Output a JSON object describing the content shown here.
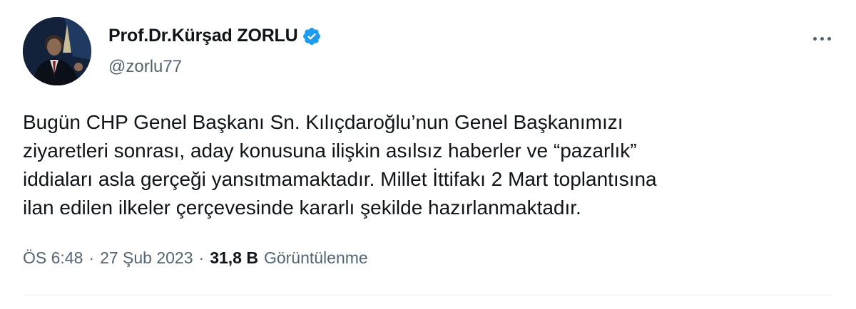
{
  "tweet": {
    "author": {
      "display_name": "Prof.Dr.Kürşad ZORLU",
      "handle": "@zorlu77",
      "verified": true
    },
    "text": "Bugün CHP Genel Başkanı Sn. Kılıçdaroğlu’nun Genel Başkanımızı\nziyaretleri sonrası, aday konusuna ilişkin asılsız haberler ve “pazarlık”\niddiaları asla gerçeği yansıtmamaktadır. Millet İttifakı 2 Mart toplantısına\nilan edilen ilkeler çerçevesinde kararlı şekilde hazırlanmaktadır.",
    "time": "ÖS 6:48",
    "separator": "·",
    "date": "27 Şub 2023",
    "views_count": "31,8 B",
    "views_label": "Görüntülenme"
  },
  "colors": {
    "verified_blue": "#1d9bf0",
    "secondary_text": "#536471",
    "primary_text": "#0f1419"
  },
  "icons": {
    "verified": "verified-badge-icon",
    "more": "more-options-icon"
  }
}
